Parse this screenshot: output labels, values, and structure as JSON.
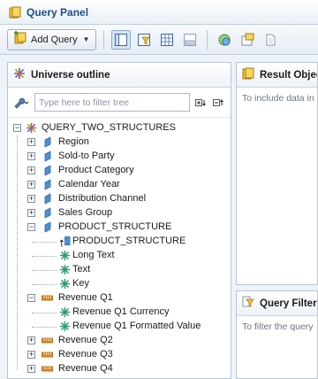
{
  "window": {
    "title": "Query Panel"
  },
  "toolbar": {
    "add_query_label": "Add Query"
  },
  "universe": {
    "title": "Universe outline",
    "filter_placeholder": "Type here to filter tree"
  },
  "tree": {
    "root": "QUERY_TWO_STRUCTURES",
    "items": [
      {
        "label": "Region",
        "level": 1,
        "icon": "dimension",
        "expander": "plus"
      },
      {
        "label": "Sold-to Party",
        "level": 1,
        "icon": "dimension",
        "expander": "plus"
      },
      {
        "label": "Product Category",
        "level": 1,
        "icon": "dimension",
        "expander": "plus"
      },
      {
        "label": "Calendar Year",
        "level": 1,
        "icon": "dimension",
        "expander": "plus"
      },
      {
        "label": "Distribution Channel",
        "level": 1,
        "icon": "dimension",
        "expander": "plus"
      },
      {
        "label": "Sales Group",
        "level": 1,
        "icon": "dimension",
        "expander": "plus"
      },
      {
        "label": "PRODUCT_STRUCTURE",
        "level": 1,
        "icon": "dimension",
        "expander": "minus"
      },
      {
        "label": "PRODUCT_STRUCTURE",
        "level": 2,
        "icon": "hierarchy",
        "expander": "none"
      },
      {
        "label": "Long Text",
        "level": 2,
        "icon": "attribute",
        "expander": "none"
      },
      {
        "label": "Text",
        "level": 2,
        "icon": "attribute",
        "expander": "none"
      },
      {
        "label": "Key",
        "level": 2,
        "icon": "attribute",
        "expander": "none"
      },
      {
        "label": "Revenue Q1",
        "level": 1,
        "icon": "measure",
        "expander": "minus"
      },
      {
        "label": "Revenue Q1 Currency",
        "level": 2,
        "icon": "attribute",
        "expander": "none"
      },
      {
        "label": "Revenue Q1 Formatted Value",
        "level": 2,
        "icon": "attribute",
        "expander": "none"
      },
      {
        "label": "Revenue Q2",
        "level": 1,
        "icon": "measure",
        "expander": "plus"
      },
      {
        "label": "Revenue Q3",
        "level": 1,
        "icon": "measure",
        "expander": "plus"
      },
      {
        "label": "Revenue Q4",
        "level": 1,
        "icon": "measure",
        "expander": "plus"
      }
    ]
  },
  "result_panel": {
    "title": "Result Objec",
    "hint": "To include data in"
  },
  "filter_panel": {
    "title": "Query Filter",
    "hint": "To filter the query"
  },
  "colors": {
    "accent": "#1b4f8a",
    "dimension": "#4a8fd8",
    "measure": "#e08a1e",
    "attribute": "#2a9d6a"
  }
}
